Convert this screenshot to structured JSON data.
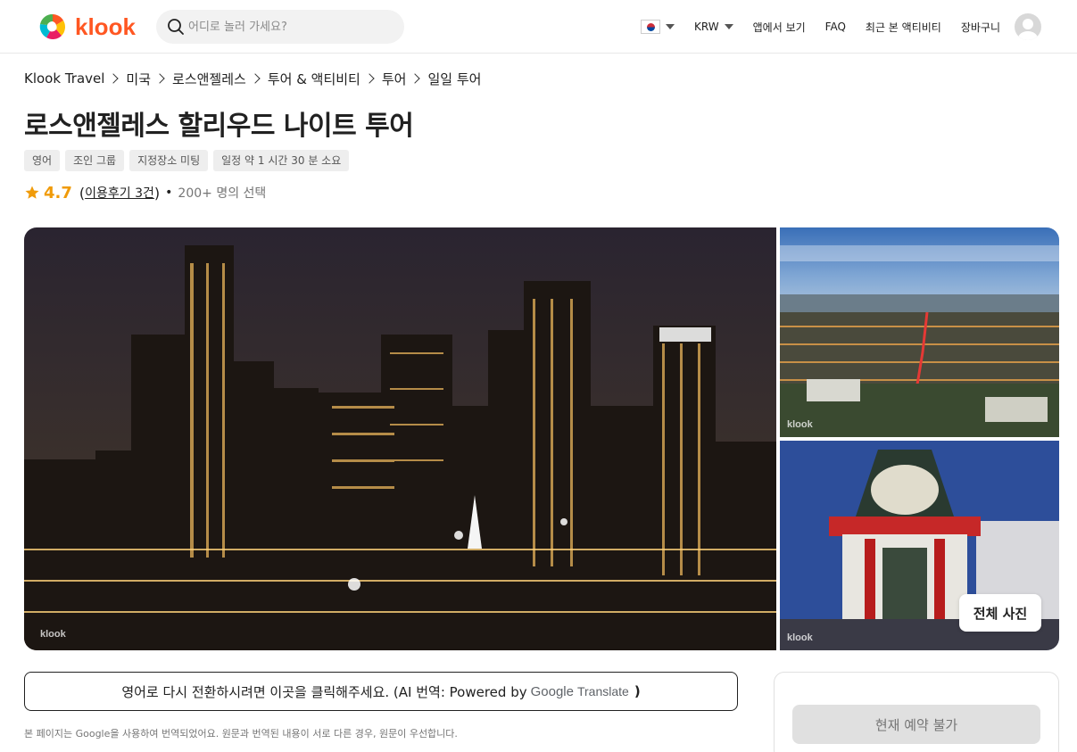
{
  "header": {
    "logo_text": "klook",
    "search_placeholder": "어디로 놀러 가세요?",
    "nav": {
      "currency": "KRW",
      "app_link": "앱에서 보기",
      "faq": "FAQ",
      "recent": "최근 본 액티비티",
      "cart": "장바구니"
    }
  },
  "breadcrumb": [
    "Klook Travel",
    "미국",
    "로스앤젤레스",
    "투어 & 액티비티",
    "투어",
    "일일 투어"
  ],
  "title": "로스앤젤레스 할리우드 나이트 투어",
  "tags": [
    "영어",
    "조인 그룹",
    "지정장소 미팅",
    "일정 약 1 시간  30 분  소요"
  ],
  "rating": {
    "score": "4.7",
    "open_paren": "(",
    "reviews_link": "이용후기 3건",
    "close_paren": ")",
    "dot": "•",
    "bookings": "200+ 명의 선택"
  },
  "gallery": {
    "watermark": "klook",
    "all_photos_label": "전체 사진"
  },
  "translation": {
    "button_text": "영어로 다시 전환하시려면 이곳을 클릭해주세요. (AI 번역: Powered by",
    "google": "Google",
    "translate": "Translate",
    "close_paren": ")",
    "notice": "본 페이지는 Google을 사용하여 번역되었어요. 원문과 번역된 내용이 서로 다른 경우, 원문이 우선합니다."
  },
  "booking": {
    "unavailable_label": "현재 예약 불가"
  },
  "colors": {
    "brand": "#ff5722",
    "rating": "#f09b0a"
  }
}
